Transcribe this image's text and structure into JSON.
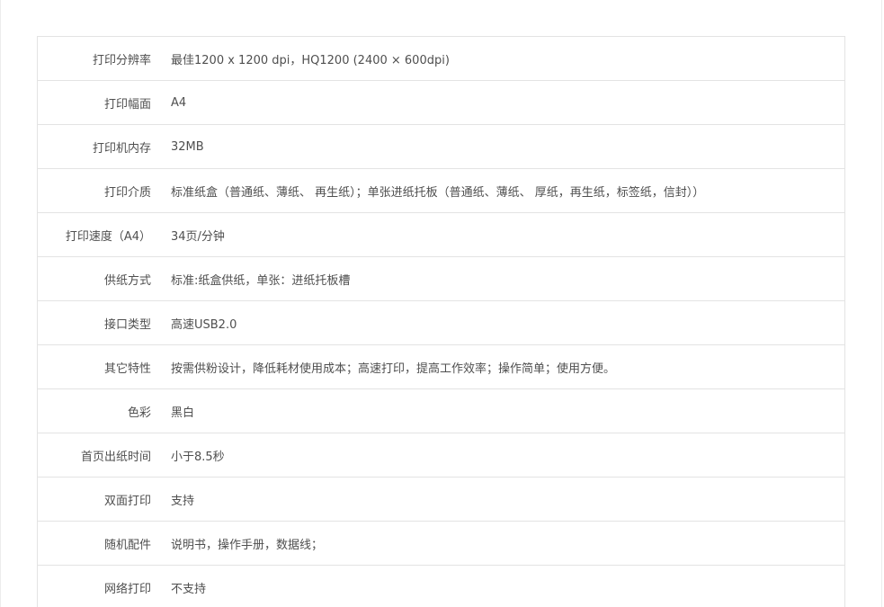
{
  "specs": [
    {
      "label": "打印分辨率",
      "value": "最佳1200 x 1200 dpi，HQ1200 (2400 × 600dpi)"
    },
    {
      "label": "打印幅面",
      "value": "A4"
    },
    {
      "label": "打印机内存",
      "value": "32MB"
    },
    {
      "label": "打印介质",
      "value": "标准纸盒（普通纸、薄纸、 再生纸）；单张进纸托板（普通纸、薄纸、 厚纸，再生纸，标签纸，信封））"
    },
    {
      "label": "打印速度（A4）",
      "value": "34页/分钟"
    },
    {
      "label": "供纸方式",
      "value": "标准:纸盒供纸，单张：进纸托板槽"
    },
    {
      "label": "接口类型",
      "value": "高速USB2.0"
    },
    {
      "label": "其它特性",
      "value": "按需供粉设计，降低耗材使用成本；高速打印，提高工作效率；操作简单；使用方便。"
    },
    {
      "label": "色彩",
      "value": "黑白"
    },
    {
      "label": "首页出纸时间",
      "value": "小于8.5秒"
    },
    {
      "label": "双面打印",
      "value": "支持"
    },
    {
      "label": "随机配件",
      "value": "说明书，操作手册，数据线；"
    },
    {
      "label": "网络打印",
      "value": "不支持"
    }
  ]
}
